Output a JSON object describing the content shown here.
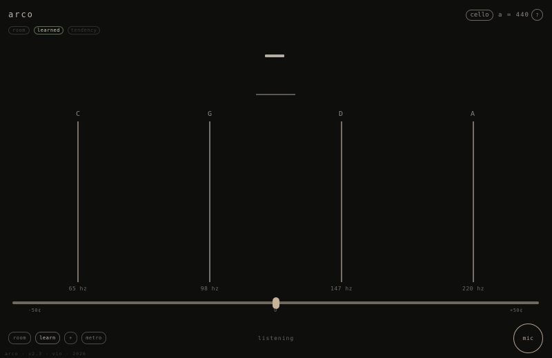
{
  "app": {
    "logo": "arco"
  },
  "mode_tabs": [
    {
      "label": "room",
      "state": "inactive"
    },
    {
      "label": "learned",
      "state": "active"
    },
    {
      "label": "tendency",
      "state": "disabled"
    }
  ],
  "header": {
    "instrument_label": "cello",
    "reference_pitch": "a = 440",
    "help_label": "?"
  },
  "strings": [
    {
      "note": "C",
      "freq": "65 hz"
    },
    {
      "note": "G",
      "freq": "98 hz"
    },
    {
      "note": "D",
      "freq": "147 hz"
    },
    {
      "note": "A",
      "freq": "220 hz"
    }
  ],
  "cents_slider": {
    "min_label": "-50¢",
    "center_label": "0",
    "max_label": "+50¢",
    "value_cents": 0
  },
  "toolbar": {
    "room_label": "room",
    "learn_label": "learn",
    "plus_label": "+",
    "metro_label": "metro"
  },
  "status_text": "listening",
  "mic_label": "mic",
  "footer_text": "arco · v2.3 · vin · 2026",
  "colors": {
    "background": "#0e0e0d",
    "accent": "#c7b299",
    "active_tab_border": "#5a6a50"
  }
}
